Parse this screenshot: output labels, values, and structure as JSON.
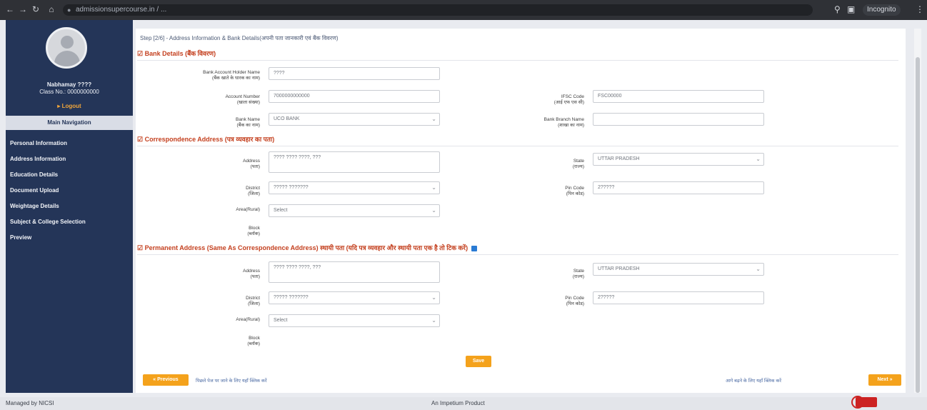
{
  "browser": {
    "url": "admissionsupercourse.in / ...",
    "profile_label": "Incognito"
  },
  "sidebar": {
    "user_name": "Nabhamay ????",
    "user_class": "Class No.: 0000000000",
    "logout": "▸ Logout",
    "main_nav_title": "Main Navigation",
    "items": [
      {
        "label": "Personal Information"
      },
      {
        "label": "Address Information"
      },
      {
        "label": "Education Details"
      },
      {
        "label": "Document Upload"
      },
      {
        "label": "Weightage Details"
      },
      {
        "label": "Subject & College Selection"
      },
      {
        "label": "Preview"
      }
    ]
  },
  "page": {
    "step_title": "Step [2/6] - Address Information & Bank Details(अपनी पता जानकारी एवं बैंक विवरण)",
    "bank": {
      "title": "☑ Bank Details (बैंक विवरण)",
      "holder_label": "Bank Account Holder Name\n(बैंक खाते के धारक का नाम)",
      "holder_value": "????",
      "account_label": "Account Number\n(खाता संख्या)",
      "account_value": "7000000000000",
      "ifsc_label": "IFSC Code\n(आई एफ एस सी)",
      "ifsc_value": "FSC00000",
      "bank_name_label": "Bank Name\n(बैंक का नाम)",
      "bank_name_value": "UCO BANK",
      "branch_label": "Bank Branch Name\n(शाखा का नाम)",
      "branch_value": ""
    },
    "correspondence": {
      "title": "☑ Correspondence Address (पत्र व्यवहार का पता)",
      "address_label": "Address\n(पता)",
      "address_value": "???? ???? ????, ???",
      "state_label": "State\n(राज्य)",
      "state_value": "UTTAR PRADESH",
      "district_label": "District\n(जिला)",
      "district_value": "????? ???????",
      "pincode_label": "Pin Code\n(पिन कोड)",
      "pincode_value": "2?????",
      "area_label": "Area(Rural)",
      "area_value": "Select",
      "block_label": "Block\n(ब्लॉक)"
    },
    "permanent": {
      "title": "☑ Permanent Address (Same As Correspondence Address) स्थायी पता (यदि पत्र व्यवहार और स्थायी पता एक है तो टिक करें)",
      "address_label": "Address\n(पता)",
      "address_value": "???? ???? ????, ???",
      "state_label": "State\n(राज्य)",
      "state_value": "UTTAR PRADESH",
      "district_label": "District\n(जिला)",
      "district_value": "????? ???????",
      "pincode_label": "Pin Code\n(पिन कोड)",
      "pincode_value": "2?????",
      "area_label": "Area(Rural)",
      "area_value": "Select",
      "block_label": "Block\n(ब्लॉक)"
    },
    "save_label": "Save",
    "prev_label": "« Previous",
    "prev_note": "पिछले पेज पर जाने के लिए यहाँ क्लिक करें",
    "next_note": "आगे बढ़ने के लिए यहाँ क्लिक करें",
    "next_label": "Next »"
  },
  "footer": {
    "left": "Managed by NICSI",
    "center": "An Impetium Product"
  },
  "colors": {
    "sidebar": "#243558",
    "accent": "#f4a21c",
    "section_title": "#c4401f"
  },
  "icons": [
    "back-icon",
    "forward-icon",
    "reload-icon",
    "lock-icon",
    "avatar-icon",
    "chevron-down-icon",
    "copy-icon",
    "menu-dots-icon"
  ]
}
